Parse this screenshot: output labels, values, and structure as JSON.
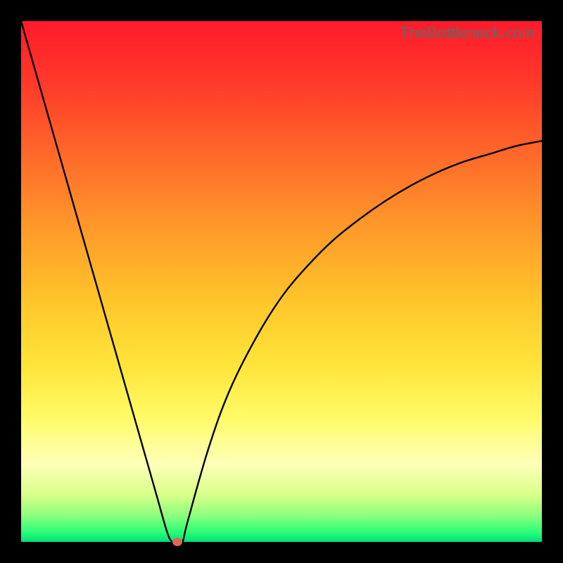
{
  "watermark": "TheBottleneck.com",
  "colors": {
    "frame": "#000000",
    "curve": "#000000",
    "marker": "#d66a5a"
  },
  "chart_data": {
    "type": "line",
    "title": "",
    "xlabel": "",
    "ylabel": "",
    "xlim": [
      0,
      100
    ],
    "ylim": [
      0,
      100
    ],
    "grid": false,
    "legend": false,
    "x": [
      0,
      4,
      8,
      12,
      16,
      20,
      24,
      26,
      28,
      29,
      30,
      31,
      32,
      36,
      40,
      45,
      50,
      55,
      60,
      65,
      70,
      75,
      80,
      85,
      90,
      95,
      100
    ],
    "values": [
      100,
      86,
      72,
      58,
      44,
      30,
      16,
      9,
      2,
      0,
      0,
      0,
      4,
      18,
      29,
      39,
      47,
      53,
      58,
      62,
      65.5,
      68.5,
      71,
      73,
      74.5,
      76,
      77
    ],
    "marker": {
      "x": 30,
      "y": 0
    },
    "background_gradient": {
      "orientation": "vertical",
      "stops": [
        {
          "pos": 0.0,
          "color": "#ff1a2b"
        },
        {
          "pos": 0.4,
          "color": "#ff9a2a"
        },
        {
          "pos": 0.7,
          "color": "#ffe43a"
        },
        {
          "pos": 0.86,
          "color": "#feffb8"
        },
        {
          "pos": 0.95,
          "color": "#8cff7c"
        },
        {
          "pos": 1.0,
          "color": "#00e07a"
        }
      ]
    }
  }
}
